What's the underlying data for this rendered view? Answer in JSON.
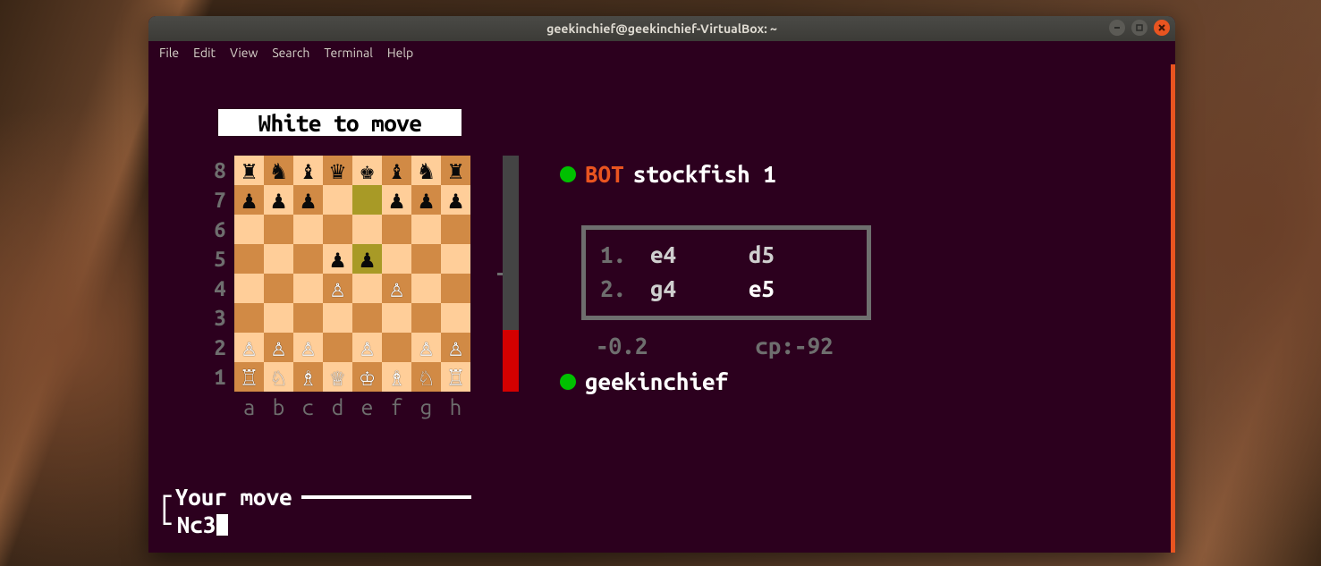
{
  "window": {
    "title": "geekinchief@geekinchief-VirtualBox: ~"
  },
  "menu": [
    "File",
    "Edit",
    "View",
    "Search",
    "Terminal",
    "Help"
  ],
  "game": {
    "status": "White to move",
    "ranks": [
      "8",
      "7",
      "6",
      "5",
      "4",
      "3",
      "2",
      "1"
    ],
    "files": [
      "a",
      "b",
      "c",
      "d",
      "e",
      "f",
      "g",
      "h"
    ],
    "board": [
      [
        "r",
        "n",
        "b",
        "q",
        "k",
        "b",
        "n",
        "r"
      ],
      [
        "p",
        "p",
        "p",
        "",
        "",
        "p",
        "p",
        "p"
      ],
      [
        "",
        "",
        "",
        "",
        "",
        "",
        "",
        ""
      ],
      [
        "",
        "",
        "",
        "p",
        "p",
        "",
        "",
        ""
      ],
      [
        "",
        "",
        "",
        "P",
        "",
        "P",
        "",
        ""
      ],
      [
        "",
        "",
        "",
        "",
        "",
        "",
        "",
        ""
      ],
      [
        "P",
        "P",
        "P",
        "",
        "P",
        "",
        "P",
        "P"
      ],
      [
        "R",
        "N",
        "B",
        "Q",
        "K",
        "B",
        "N",
        "R"
      ]
    ],
    "highlights": [
      [
        1,
        4
      ],
      [
        3,
        4
      ]
    ],
    "eval_bar": {
      "bad_fraction": 0.26,
      "tick_fraction": 0.5
    },
    "top_player": {
      "tag": "BOT",
      "name": "stockfish 1"
    },
    "bottom_player": {
      "name": "geekinchief"
    },
    "moves": [
      {
        "n": "1.",
        "w": "e4",
        "b": "d5"
      },
      {
        "n": "2.",
        "w": "g4",
        "b": "e5"
      }
    ],
    "score": "-0.2",
    "cp": "cp:-92"
  },
  "prompt": {
    "label": "Your move",
    "input": "Nc3"
  }
}
